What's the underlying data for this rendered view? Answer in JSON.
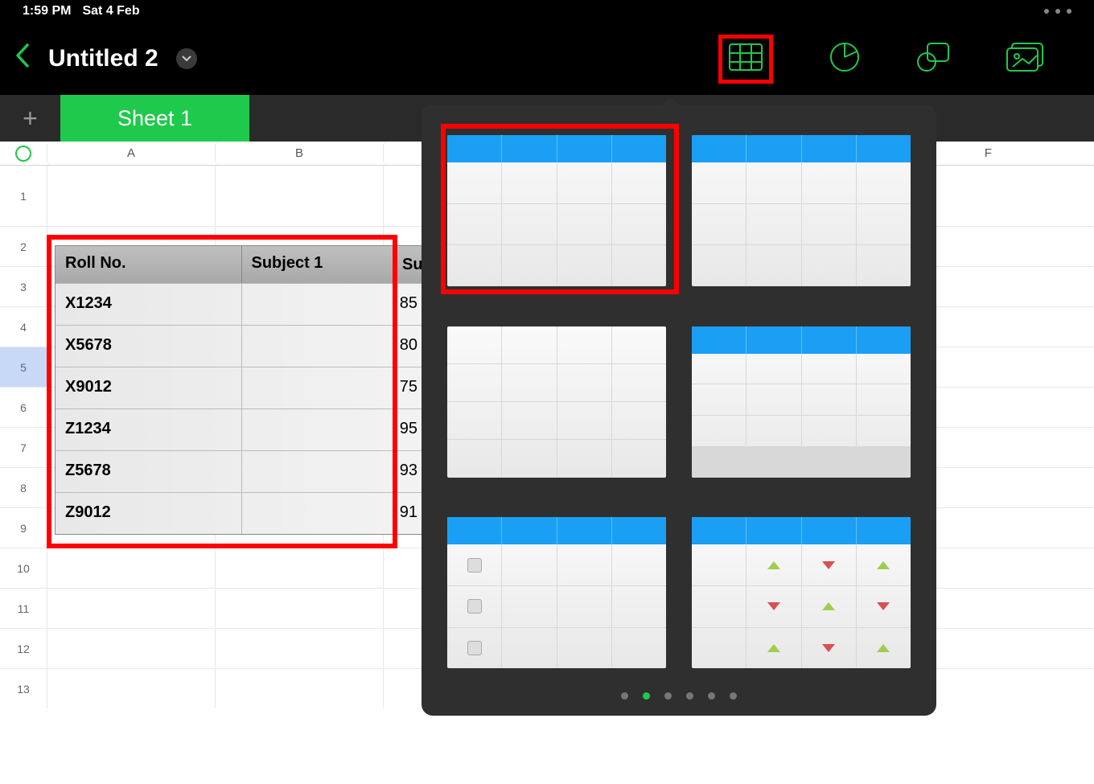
{
  "status": {
    "time": "1:59 PM",
    "date": "Sat 4 Feb"
  },
  "document": {
    "title": "Untitled 2"
  },
  "tabs": {
    "sheet1": "Sheet 1"
  },
  "columns": {
    "A": "A",
    "B": "B",
    "F": "F"
  },
  "rows": [
    "1",
    "2",
    "3",
    "4",
    "5",
    "6",
    "7",
    "8",
    "9",
    "10",
    "11",
    "12",
    "13"
  ],
  "table": {
    "headers": {
      "col1": "Roll No.",
      "col2": "Subject 1",
      "col3_partial": "Su"
    },
    "data": [
      {
        "roll": "X1234",
        "s1": "85"
      },
      {
        "roll": "X5678",
        "s1": "80"
      },
      {
        "roll": "X9012",
        "s1": "75"
      },
      {
        "roll": "Z1234",
        "s1": "95"
      },
      {
        "roll": "Z5678",
        "s1": "93"
      },
      {
        "roll": "Z9012",
        "s1": "91"
      }
    ]
  },
  "popover": {
    "page_count": 6,
    "active_page": 1
  }
}
